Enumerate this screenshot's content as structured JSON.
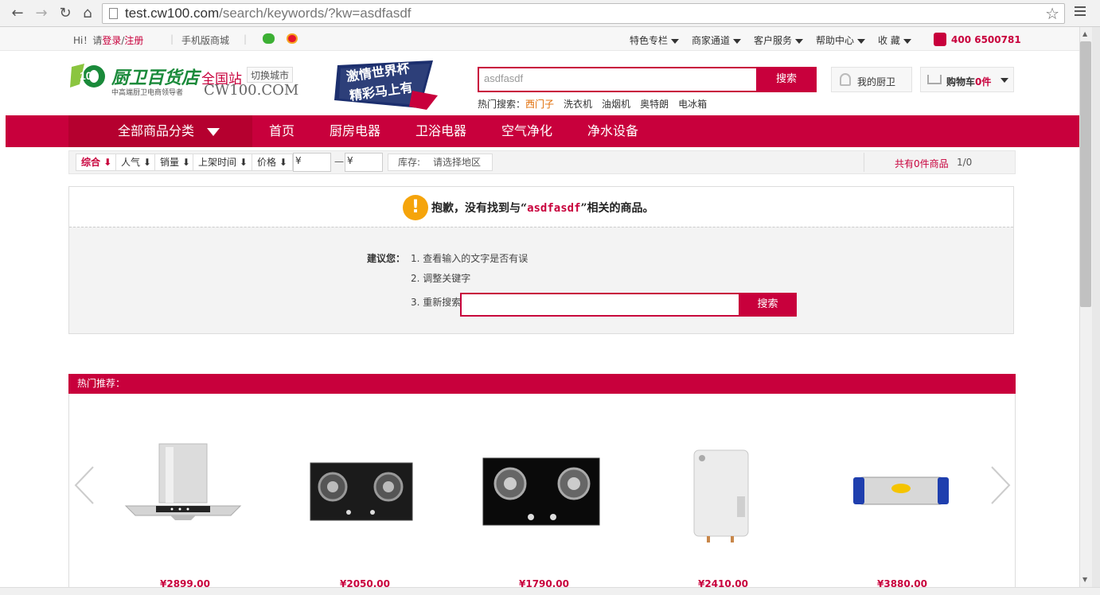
{
  "browser": {
    "url_host": "test.cw100.com",
    "url_path": "/search/keywords/?kw=asdfasdf"
  },
  "topbar": {
    "greeting": "Hi！请",
    "login": "登录",
    "slash": "/",
    "register": "注册",
    "mobile": "手机版商城",
    "links": [
      "特色专栏",
      "商家通道",
      "客户服务",
      "帮助中心",
      "收 藏"
    ],
    "phone": "400 6500781"
  },
  "header": {
    "logo_text": "厨卫百货店",
    "logo_sub": "中高端厨卫电商领导者",
    "site_name": "全国站",
    "switch_city": "切换城市",
    "domain": "CW100.COM",
    "banner_line1": "激情世界杯",
    "banner_line2": "精彩马上有",
    "search_value": "asdfasdf",
    "search_button": "搜索",
    "hot_label": "热门搜索：",
    "hot_terms": [
      "西门子",
      "洗衣机",
      "油烟机",
      "奥特朗",
      "电冰箱"
    ],
    "my_account": "我的厨卫",
    "cart_prefix": "购物车",
    "cart_count": "0件"
  },
  "nav": {
    "all_categories": "全部商品分类",
    "items": [
      "首页",
      "厨房电器",
      "卫浴电器",
      "空气净化",
      "净水设备"
    ]
  },
  "filter": {
    "sorts": [
      "综合",
      "人气",
      "销量",
      "上架时间",
      "价格"
    ],
    "price_from": "¥",
    "dash": "—",
    "price_to": "¥",
    "stock_label": "库存:",
    "stock_value": "请选择地区",
    "total": "共有0件商品",
    "pager": "1/0"
  },
  "noresult": {
    "msg_before": "抱歉，没有找到与“",
    "keyword": "asdfasdf",
    "msg_after": "”相关的商品。",
    "suggest_label": "建议您：",
    "suggestions": [
      "1. 查看输入的文字是否有误",
      "2. 调整关键字",
      "3. 重新搜索"
    ],
    "search_button": "搜索"
  },
  "hot": {
    "title": "热门推荐：",
    "products": [
      {
        "price": "¥2899.00",
        "icon": "range-hood"
      },
      {
        "price": "¥2050.00",
        "icon": "gas-stove"
      },
      {
        "price": "¥1790.00",
        "icon": "gas-stove"
      },
      {
        "price": "¥2410.00",
        "icon": "water-heater"
      },
      {
        "price": "¥3880.00",
        "icon": "water-purifier"
      }
    ]
  },
  "colors": {
    "brand": "#c8003c",
    "warning": "#f5a40b",
    "highlight": "#e06a00"
  }
}
